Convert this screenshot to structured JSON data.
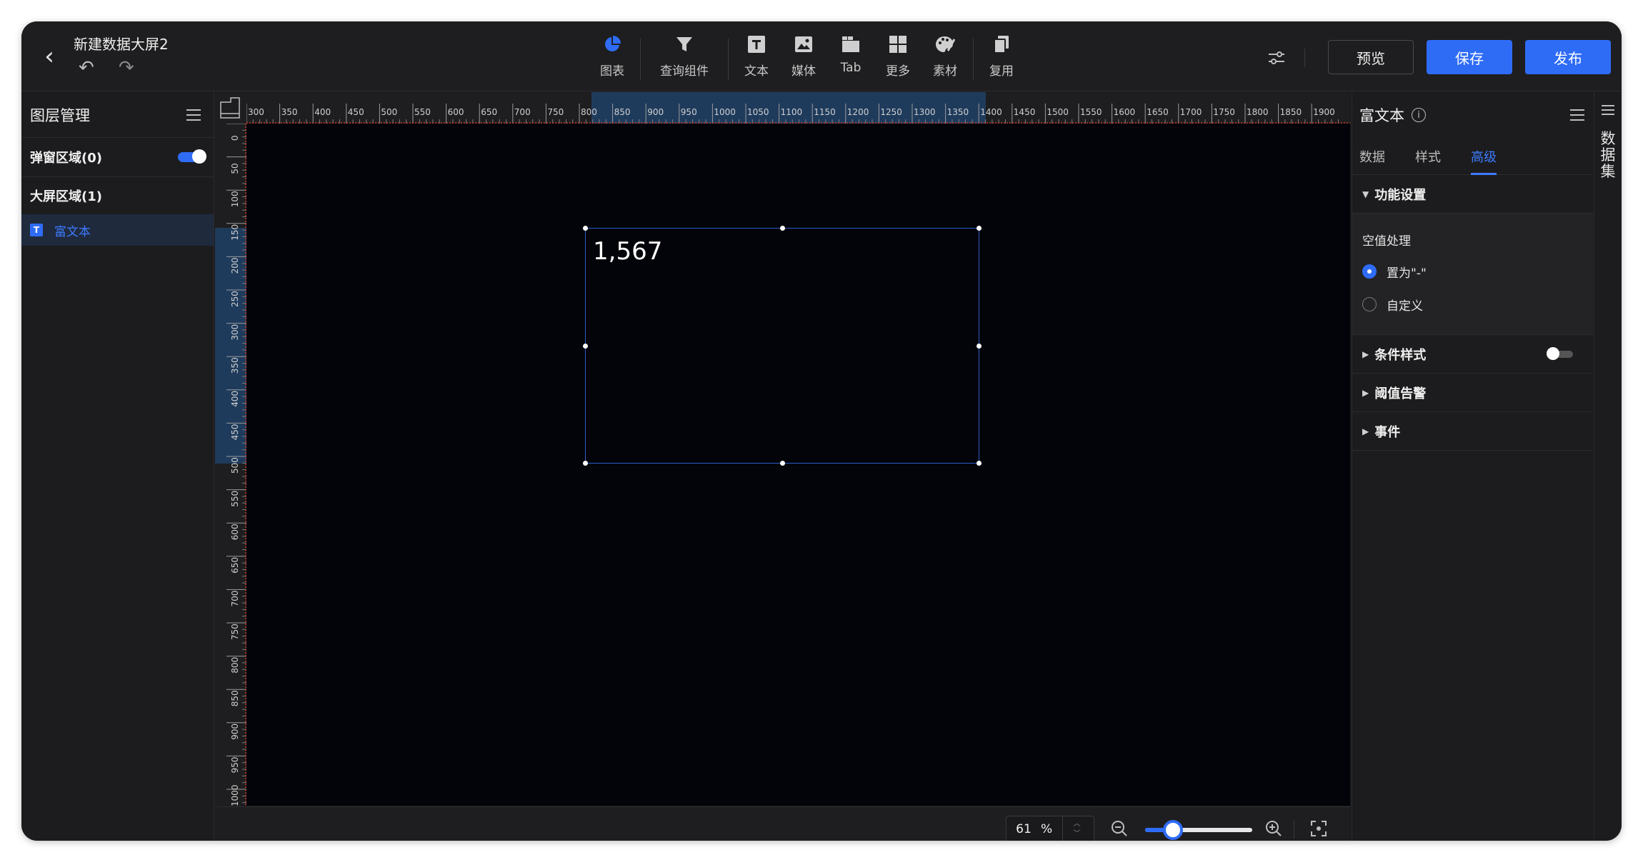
{
  "header": {
    "title": "新建数据大屏2",
    "tools": [
      {
        "name": "chart",
        "label": "图表",
        "icon": "pie-chart-icon",
        "color": "#2f6cf6"
      },
      {
        "name": "query",
        "label": "查询组件",
        "icon": "filter-icon"
      },
      {
        "name": "text",
        "label": "文本",
        "icon": "text-icon"
      },
      {
        "name": "media",
        "label": "媒体",
        "icon": "image-icon"
      },
      {
        "name": "tab",
        "label": "Tab",
        "icon": "tab-icon"
      },
      {
        "name": "more",
        "label": "更多",
        "icon": "grid-icon"
      },
      {
        "name": "material",
        "label": "素材",
        "icon": "palette-icon"
      },
      {
        "name": "reuse",
        "label": "复用",
        "icon": "copy-icon"
      }
    ],
    "preview_label": "预览",
    "save_label": "保存",
    "publish_label": "发布"
  },
  "left_panel": {
    "title": "图层管理",
    "popup_zone": "弹窗区域(0)",
    "popup_toggle_on": true,
    "screen_zone": "大屏区域(1)",
    "layers": [
      {
        "icon": "T",
        "name": "富文本"
      }
    ]
  },
  "canvas": {
    "h_ruler_labels": [
      "300",
      "350",
      "400",
      "450",
      "500",
      "550",
      "600",
      "650",
      "700",
      "750",
      "800",
      "850",
      "900",
      "950",
      "1000",
      "1050",
      "1100",
      "1150",
      "1200",
      "1250",
      "1300",
      "1350",
      "1400",
      "1450",
      "1500",
      "1550",
      "1600",
      "1650",
      "1700",
      "1750",
      "1800",
      "1850",
      "1900"
    ],
    "v_ruler_labels": [
      "0",
      "50",
      "100",
      "150",
      "200",
      "250",
      "300",
      "350",
      "400",
      "450",
      "500",
      "550",
      "600",
      "650",
      "700",
      "750",
      "800",
      "850",
      "900",
      "950",
      "1000"
    ],
    "selected_value": "1,567",
    "zoom_value": "61",
    "zoom_unit": "%",
    "zoom_fraction": 0.26
  },
  "right_panel": {
    "title": "富文本",
    "tabs": [
      "数据",
      "样式",
      "高级"
    ],
    "active_tab": 2,
    "sections": {
      "function": "功能设置",
      "null_handling": "空值处理",
      "options": [
        "置为\"-\"",
        "自定义"
      ],
      "selected_option": 0,
      "conditional_style": "条件样式",
      "threshold_alert": "阈值告警",
      "event": "事件"
    }
  },
  "far_right": {
    "label": "数据集"
  }
}
